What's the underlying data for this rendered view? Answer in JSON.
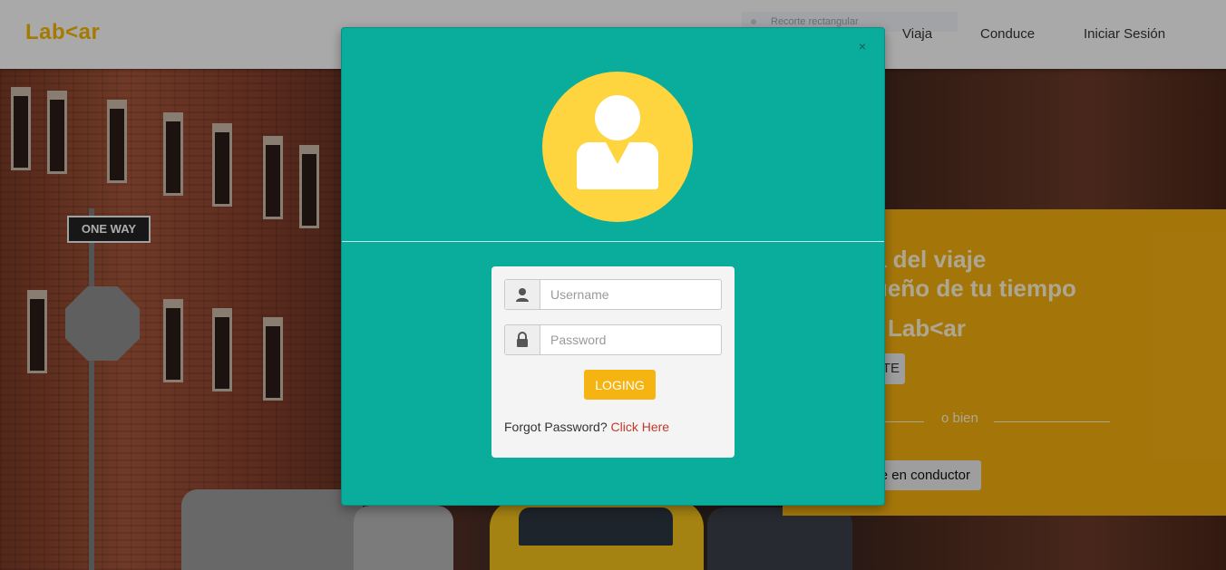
{
  "navbar": {
    "logo": "Lab<ar",
    "items": [
      "Viaja",
      "Conduce",
      "Iniciar Sesión"
    ],
    "snip_label": "Recorte rectangular"
  },
  "background": {
    "sign_text": "ONE WAY"
  },
  "hero": {
    "line1": "a del viaje",
    "line2": "ueño de tu tiempo",
    "brand": "Lab<ar",
    "button1_label": "TE",
    "or_text": "o bien",
    "button2_label": "e en conductor"
  },
  "modal": {
    "close_label": "×",
    "username_placeholder": "Username",
    "password_placeholder": "Password",
    "login_label": "LOGING",
    "forgot_text": "Forgot Password?",
    "forgot_link": "Click Here"
  },
  "colors": {
    "brand": "#f4b400",
    "modal_bg": "#0aac9b",
    "avatar": "#ffd53f",
    "button": "#f5b412",
    "link": "#c0392b"
  }
}
